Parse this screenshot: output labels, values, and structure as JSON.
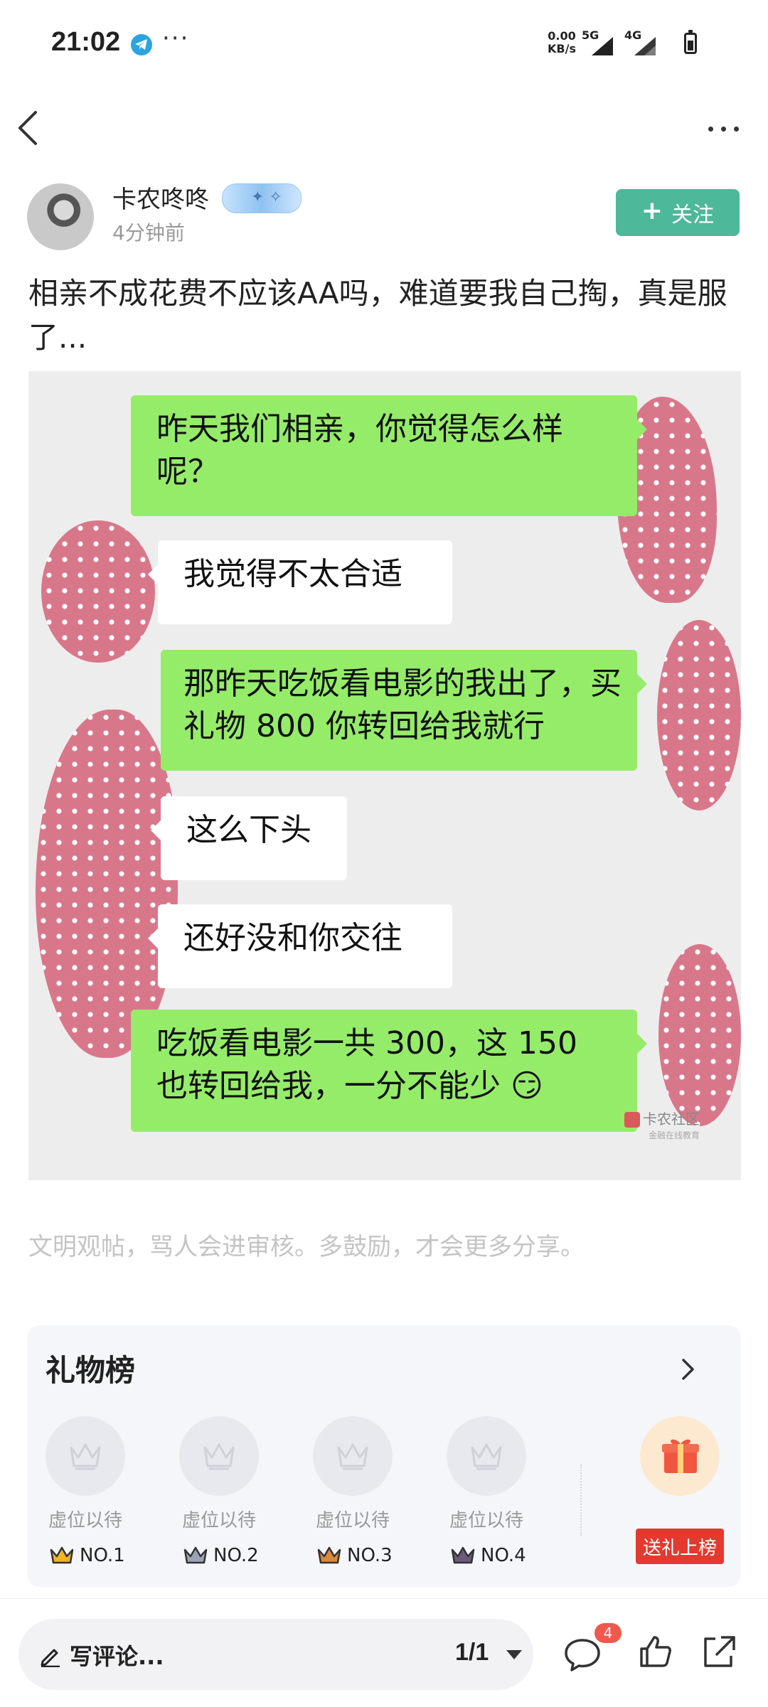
{
  "status_bar": {
    "time": "21:02",
    "more": "···",
    "net_speed_value": "0.00",
    "net_speed_unit": "KB/s",
    "net_5g": "5G",
    "net_4g": "4G"
  },
  "author": {
    "name": "卡农咚咚",
    "time_ago": "4分钟前",
    "follow_label": "关注"
  },
  "post": {
    "text": "相亲不成花费不应该AA吗，难道要我自己掏，真是服了...",
    "image": {
      "messages": [
        {
          "side": "right",
          "text": "昨天我们相亲，你觉得怎么样呢？"
        },
        {
          "side": "left",
          "text": "我觉得不太合适"
        },
        {
          "side": "right",
          "text": "那昨天吃饭看电影的我出了，买礼物 800 你转回给我就行"
        },
        {
          "side": "left",
          "text": "这么下头"
        },
        {
          "side": "left",
          "text": "还好没和你交往"
        },
        {
          "side": "right",
          "text": "吃饭看电影一共 300，这 150 也转回给我，一分不能少"
        }
      ],
      "watermark": "卡农社区",
      "watermark_sub": "金融在线教育"
    }
  },
  "notice": "文明观帖，骂人会进审核。多鼓励，才会更多分享。",
  "gift_board": {
    "title": "礼物榜",
    "slots": [
      {
        "label": "虚位以待",
        "rank": "NO.1",
        "crown_color": "#f0b323"
      },
      {
        "label": "虚位以待",
        "rank": "NO.2",
        "crown_color": "#9aa3b5"
      },
      {
        "label": "虚位以待",
        "rank": "NO.3",
        "crown_color": "#d98a3c"
      },
      {
        "label": "虚位以待",
        "rank": "NO.4",
        "crown_color": "#6b5a7a"
      }
    ],
    "send_label": "送礼上榜"
  },
  "bottom_bar": {
    "comment_placeholder": "写评论...",
    "page": "1/1",
    "comment_count": "4"
  },
  "colors": {
    "accent": "#4db89a",
    "chat_green": "#95ec69",
    "red": "#e3392f"
  }
}
